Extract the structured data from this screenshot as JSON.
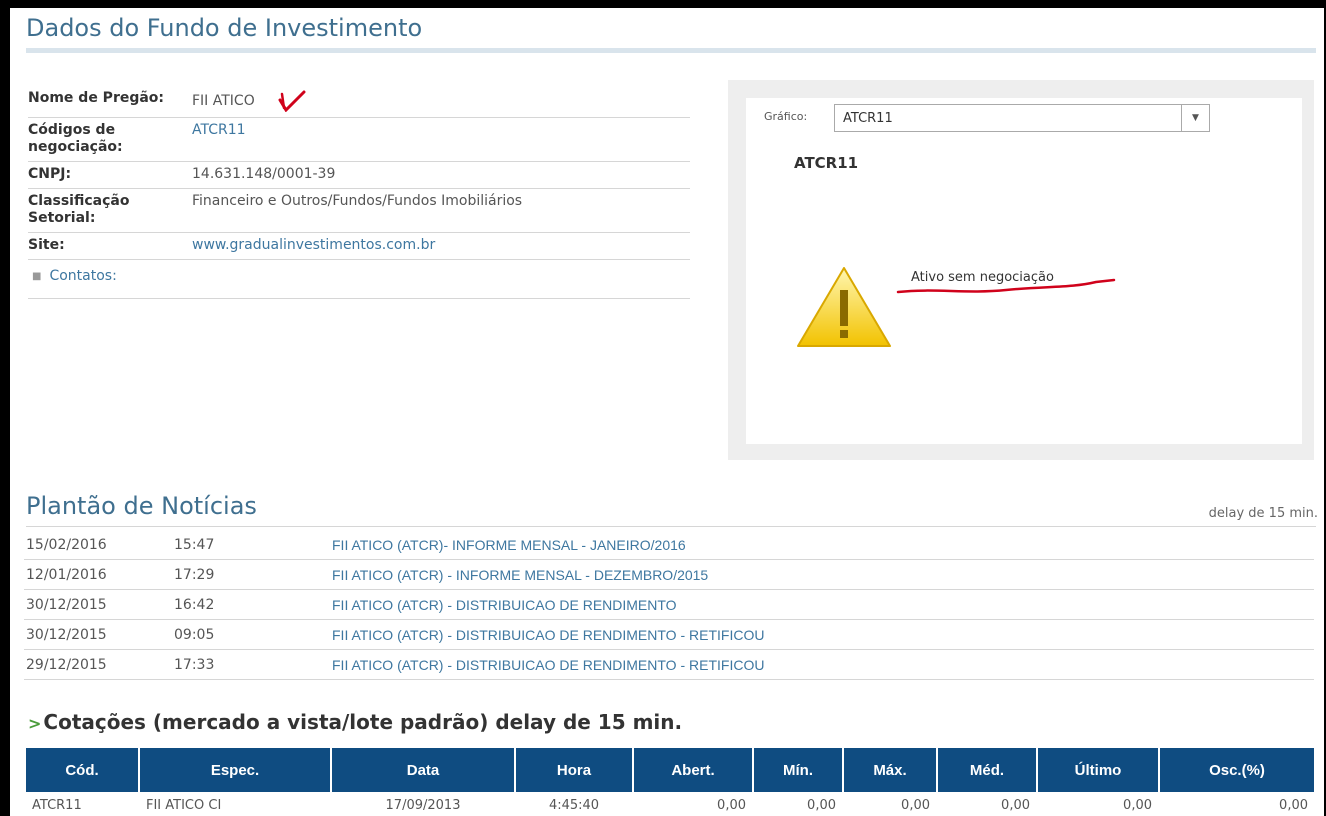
{
  "fund_section": {
    "title": "Dados do Fundo de Investimento",
    "rows": [
      {
        "label": "Nome de Pregão:",
        "value": "FII ATICO"
      },
      {
        "label": "Códigos de negociação:",
        "value": "ATCR11"
      },
      {
        "label": "CNPJ:",
        "value": "14.631.148/0001-39"
      },
      {
        "label": "Classificação Setorial:",
        "value": "Financeiro e Outros/Fundos/Fundos Imobiliários"
      },
      {
        "label": "Site:",
        "value": "www.gradualinvestimentos.com.br"
      }
    ],
    "contacts_label": "Contatos:"
  },
  "chart_panel": {
    "label": "Gráfico:",
    "selected": "ATCR11",
    "ticker": "ATCR11",
    "message": "Ativo sem negociação"
  },
  "news": {
    "title": "Plantão de Notícias",
    "delay_note": "delay de 15 min.",
    "items": [
      {
        "date": "15/02/2016",
        "time": "15:47",
        "headline": "FII ATICO (ATCR)- INFORME MENSAL - JANEIRO/2016"
      },
      {
        "date": "12/01/2016",
        "time": "17:29",
        "headline": "FII ATICO (ATCR) - INFORME MENSAL - DEZEMBRO/2015"
      },
      {
        "date": "30/12/2015",
        "time": "16:42",
        "headline": "FII ATICO (ATCR) - DISTRIBUICAO DE RENDIMENTO"
      },
      {
        "date": "30/12/2015",
        "time": "09:05",
        "headline": "FII ATICO (ATCR) - DISTRIBUICAO DE RENDIMENTO - RETIFICOU"
      },
      {
        "date": "29/12/2015",
        "time": "17:33",
        "headline": "FII ATICO (ATCR) - DISTRIBUICAO DE RENDIMENTO - RETIFICOU"
      }
    ]
  },
  "quotes": {
    "title": "Cotações (mercado a vista/lote padrão) delay de 15 min.",
    "headers": [
      "Cód.",
      "Espec.",
      "Data",
      "Hora",
      "Abert.",
      "Mín.",
      "Máx.",
      "Méd.",
      "Último",
      "Osc.(%)"
    ],
    "row": [
      "ATCR11",
      "FII ATICO CI",
      "17/09/2013",
      "4:45:40",
      "0,00",
      "0,00",
      "0,00",
      "0,00",
      "0,00",
      "0,00"
    ]
  },
  "colors": {
    "accent": "#3f6f8f",
    "link": "#3e77a0",
    "table_header": "#0f4c81",
    "annotation": "#d0021b"
  }
}
